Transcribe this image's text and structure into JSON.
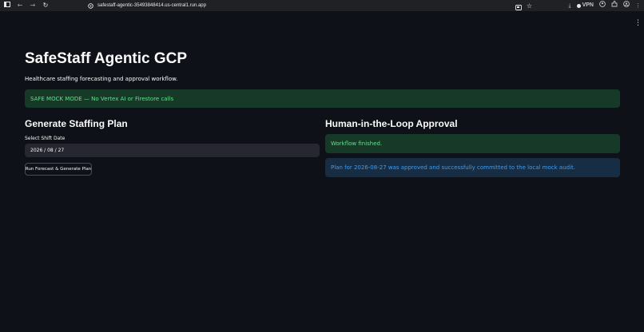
{
  "browser": {
    "url": "safestaff-agentic-35493848414.us-central1.run.app",
    "vpn_label": "VPN"
  },
  "app": {
    "title": "SafeStaff Agentic GCP",
    "subtitle": "Healthcare staffing forecasting and approval workflow.",
    "mock_alert": "SAFE MOCK MODE — No Vertex AI or Firestore calls"
  },
  "left": {
    "heading": "Generate Staffing Plan",
    "date_label": "Select Shift Date",
    "date_value": "2026 / 08 / 27",
    "button_label": "Run Forecast & Generate Plan"
  },
  "right": {
    "heading": "Human-in-the-Loop Approval",
    "status": "Workflow finished.",
    "info": "Plan for 2026-08-27 was approved and successfully committed to the local mock audit."
  },
  "colors": {
    "background": "#0e1117",
    "success_bg": "#173928",
    "success_text": "#5ce488",
    "info_bg": "#172d43",
    "info_text": "#3d9df3"
  }
}
